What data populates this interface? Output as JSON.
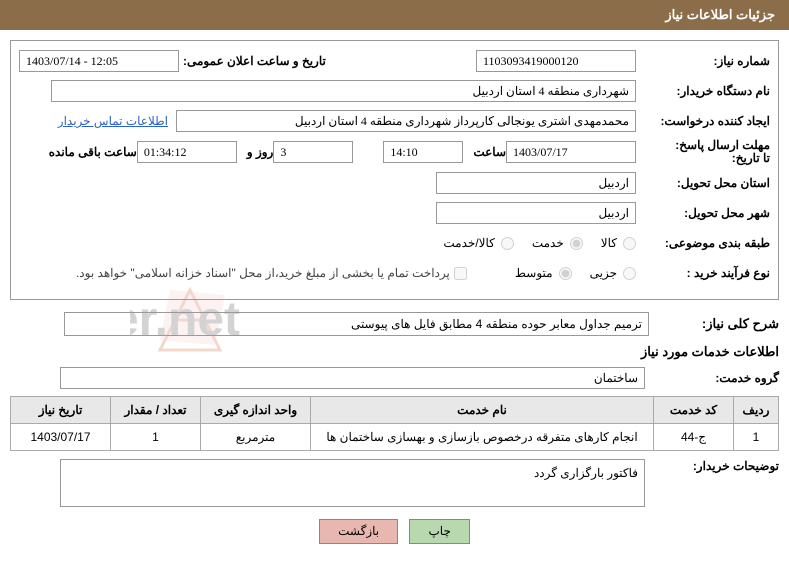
{
  "header": {
    "title": "جزئیات اطلاعات نیاز"
  },
  "form": {
    "req_no_label": "شماره نیاز:",
    "req_no": "1103093419000120",
    "announce_label": "تاریخ و ساعت اعلان عمومی:",
    "announce_val": "1403/07/14 - 12:05",
    "buyer_label": "نام دستگاه خریدار:",
    "buyer_val": "شهرداری منطقه 4 استان اردبیل",
    "requester_label": "ایجاد کننده درخواست:",
    "requester_val": "محمدمهدی اشتری یونجالی کارپرداز شهرداری منطقه 4 استان اردبیل",
    "contact_link": "اطلاعات تماس خریدار",
    "deadline_label": "مهلت ارسال پاسخ:",
    "to_label": "تا تاریخ:",
    "deadline_date": "1403/07/17",
    "time_label": "ساعت",
    "deadline_time": "14:10",
    "days_val": "3",
    "days_suffix": "روز و",
    "countdown": "01:34:12",
    "remaining_suffix": "ساعت باقی مانده",
    "province_label": "استان محل تحویل:",
    "province_val": "اردبیل",
    "city_label": "شهر محل تحویل:",
    "city_val": "اردبیل",
    "subject_class_label": "طبقه بندی موضوعی:",
    "goods": "کالا",
    "service": "خدمت",
    "goods_service": "کالا/خدمت",
    "proc_type_label": "نوع فرآیند خرید :",
    "minor": "جزیی",
    "medium": "متوسط",
    "payment_note": "پرداخت تمام یا بخشی از مبلغ خرید،از محل \"اسناد خزانه اسلامی\" خواهد بود.",
    "overall_label": "شرح کلی نیاز:",
    "overall_val": "ترمیم جداول معابر حوده منطقه 4 مطابق فایل های پیوستی",
    "services_label": "اطلاعات خدمات مورد نیاز",
    "group_label": "گروه خدمت:",
    "group_val": "ساختمان",
    "buyer_desc_label": "توضیحات خریدار:",
    "buyer_desc_val": "فاکتور بارگزاری گردد"
  },
  "table": {
    "headers": {
      "row": "ردیف",
      "code": "کد خدمت",
      "name": "نام خدمت",
      "unit": "واحد اندازه گیری",
      "qty": "تعداد / مقدار",
      "need_date": "تاریخ نیاز"
    },
    "rows": [
      {
        "row": "1",
        "code": "ج-44",
        "name": "انجام کارهای متفرقه درخصوص بازسازی و بهسازی ساختمان ها",
        "unit": "مترمربع",
        "qty": "1",
        "need_date": "1403/07/17"
      }
    ]
  },
  "buttons": {
    "print": "چاپ",
    "back": "بازگشت"
  }
}
